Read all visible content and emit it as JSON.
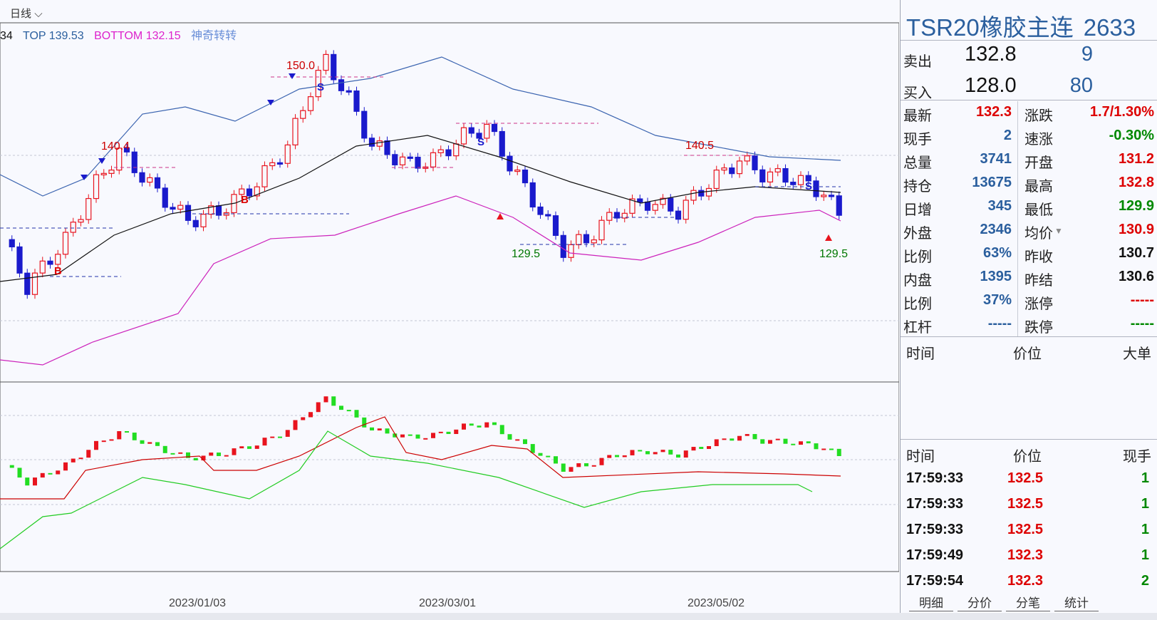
{
  "chart": {
    "period_label": "日线",
    "legend": [
      {
        "text": "34",
        "color": "#111111"
      },
      {
        "text": "TOP 139.53",
        "color": "#2b5f9e"
      },
      {
        "text": "BOTTOM 132.15",
        "color": "#dd22cc"
      },
      {
        "text": "神奇转转",
        "color": "#6a8fd8"
      }
    ],
    "price_labels": [
      {
        "text": "150.0",
        "color": "#cc0000"
      },
      {
        "text": "140.4",
        "color": "#cc0000"
      },
      {
        "text": "140.5",
        "color": "#cc0000"
      },
      {
        "text": "129.5",
        "color": "#007700"
      },
      {
        "text": "129.5",
        "color": "#007700"
      }
    ],
    "date_labels": [
      "2023/01/03",
      "2023/03/01",
      "2023/05/02"
    ],
    "signal_b": "B",
    "signal_s": "S",
    "colors": {
      "up": "#e8141e",
      "down": "#1a1acc",
      "upper_band": "#3b64b0",
      "lower_band": "#cc22bb",
      "mid_line": "#111111",
      "green_bar": "#22dd22",
      "red_line": "#cc0000",
      "green_line": "#22cc22"
    }
  },
  "panel": {
    "name": "TSR20橡胶主连",
    "code": "2633",
    "sell": {
      "label": "卖出",
      "price": "132.8",
      "volume": "9"
    },
    "buy": {
      "label": "买入",
      "price": "128.0",
      "volume": "80"
    },
    "rows": [
      {
        "l": "最新",
        "v": "132.3",
        "vc": "#dd0000",
        "l2": "涨跌",
        "v2": "1.7/1.30%",
        "v2c": "#dd0000"
      },
      {
        "l": "现手",
        "v": "2",
        "vc": "#2b5f9e",
        "l2": "速涨",
        "v2": "-0.30%",
        "v2c": "#008800"
      },
      {
        "l": "总量",
        "v": "3741",
        "vc": "#2b5f9e",
        "l2": "开盘",
        "v2": "131.2",
        "v2c": "#dd0000"
      },
      {
        "l": "持仓",
        "v": "13675",
        "vc": "#2b5f9e",
        "l2": "最高",
        "v2": "132.8",
        "v2c": "#dd0000"
      },
      {
        "l": "日增",
        "v": "345",
        "vc": "#2b5f9e",
        "l2": "最低",
        "v2": "129.9",
        "v2c": "#008800"
      },
      {
        "l": "外盘",
        "v": "2346",
        "vc": "#2b5f9e",
        "l2": "均价",
        "v2": "130.9",
        "v2c": "#dd0000"
      },
      {
        "l": "比例",
        "v": "63%",
        "vc": "#2b5f9e",
        "l2": "昨收",
        "v2": "130.7",
        "v2c": "#111111"
      },
      {
        "l": "内盘",
        "v": "1395",
        "vc": "#2b5f9e",
        "l2": "昨结",
        "v2": "130.6",
        "v2c": "#111111"
      },
      {
        "l": "比例",
        "v": "37%",
        "vc": "#2b5f9e",
        "l2": "涨停",
        "v2": "-----",
        "v2c": "#dd0000"
      },
      {
        "l": "杠杆",
        "v": "-----",
        "vc": "#2b5f9e",
        "l2": "跌停",
        "v2": "-----",
        "v2c": "#008800"
      }
    ],
    "big_order_header": {
      "time": "时间",
      "price": "价位",
      "size": "大单"
    },
    "tick_header": {
      "time": "时间",
      "price": "价位",
      "size": "现手"
    },
    "ticks": [
      {
        "time": "17:59:33",
        "price": "132.5",
        "size": "1"
      },
      {
        "time": "17:59:33",
        "price": "132.5",
        "size": "1"
      },
      {
        "time": "17:59:33",
        "price": "132.5",
        "size": "1"
      },
      {
        "time": "17:59:49",
        "price": "132.3",
        "size": "1"
      },
      {
        "time": "17:59:54",
        "price": "132.3",
        "size": "2"
      }
    ],
    "tabs": [
      "明细",
      "分价",
      "分笔",
      "统计"
    ]
  }
}
